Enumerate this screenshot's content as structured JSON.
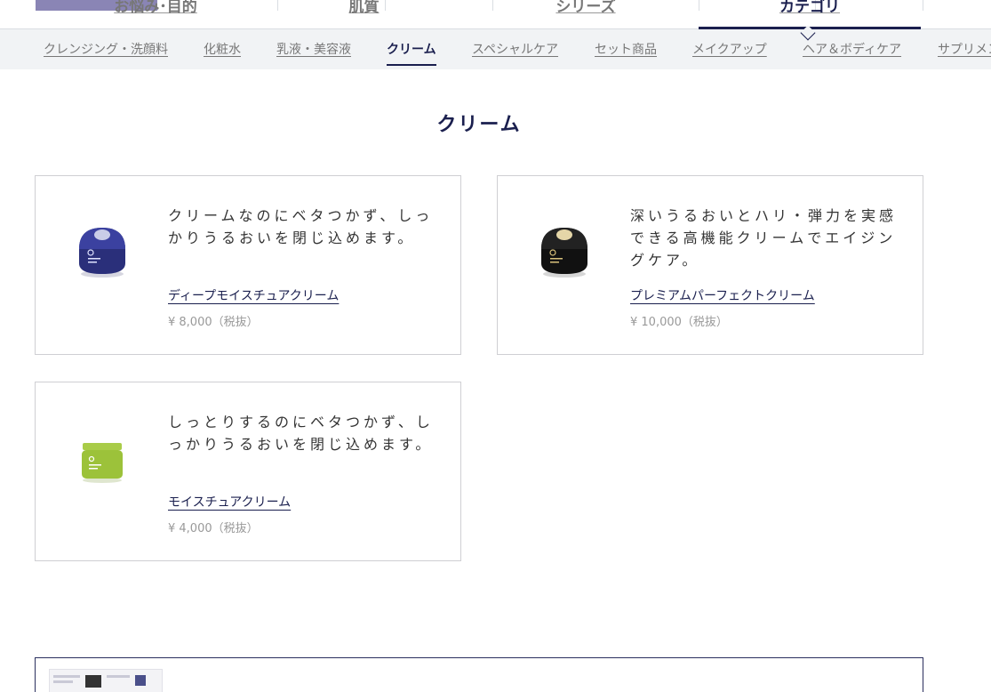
{
  "top_tabs": [
    {
      "label": "お悩み･目的",
      "active": false
    },
    {
      "label": "肌質",
      "active": false
    },
    {
      "label": "シリーズ",
      "active": false
    },
    {
      "label": "カテゴリ",
      "active": true
    }
  ],
  "sub_nav": {
    "items": [
      "クレンジング・洗顔料",
      "化粧水",
      "乳液・美容液",
      "クリーム",
      "スペシャルケア",
      "セット商品",
      "メイクアップ",
      "ヘア＆ボディケア",
      "サプリメント"
    ],
    "active": "クリーム"
  },
  "section_title": "クリーム",
  "products": [
    {
      "description": "クリームなのにベタつかず、しっかりうるおいを閉じ込めます。",
      "name": "ディープモイスチュアクリーム",
      "price": "¥ 8,000（税抜）",
      "icon": "navy-cream-jar-icon",
      "jar_color": "#2a2f7a"
    },
    {
      "description": "深いうるおいとハリ・弾力を実感できる高機能クリームでエイジングケア。",
      "name": "プレミアムパーフェクトクリーム",
      "price": "¥ 10,000（税抜）",
      "icon": "black-gold-cream-jar-icon",
      "jar_color": "#111111"
    },
    {
      "description": "しっとりするのにベタつかず、しっかりうるおいを閉じ込めます。",
      "name": "モイスチュアクリーム",
      "price": "¥ 4,000（税抜）",
      "icon": "green-cream-jar-icon",
      "jar_color": "#9cc23a"
    }
  ],
  "colors": {
    "accent": "#1a1f4e",
    "nav_bg": "#f1f3f5",
    "price": "#999999"
  }
}
